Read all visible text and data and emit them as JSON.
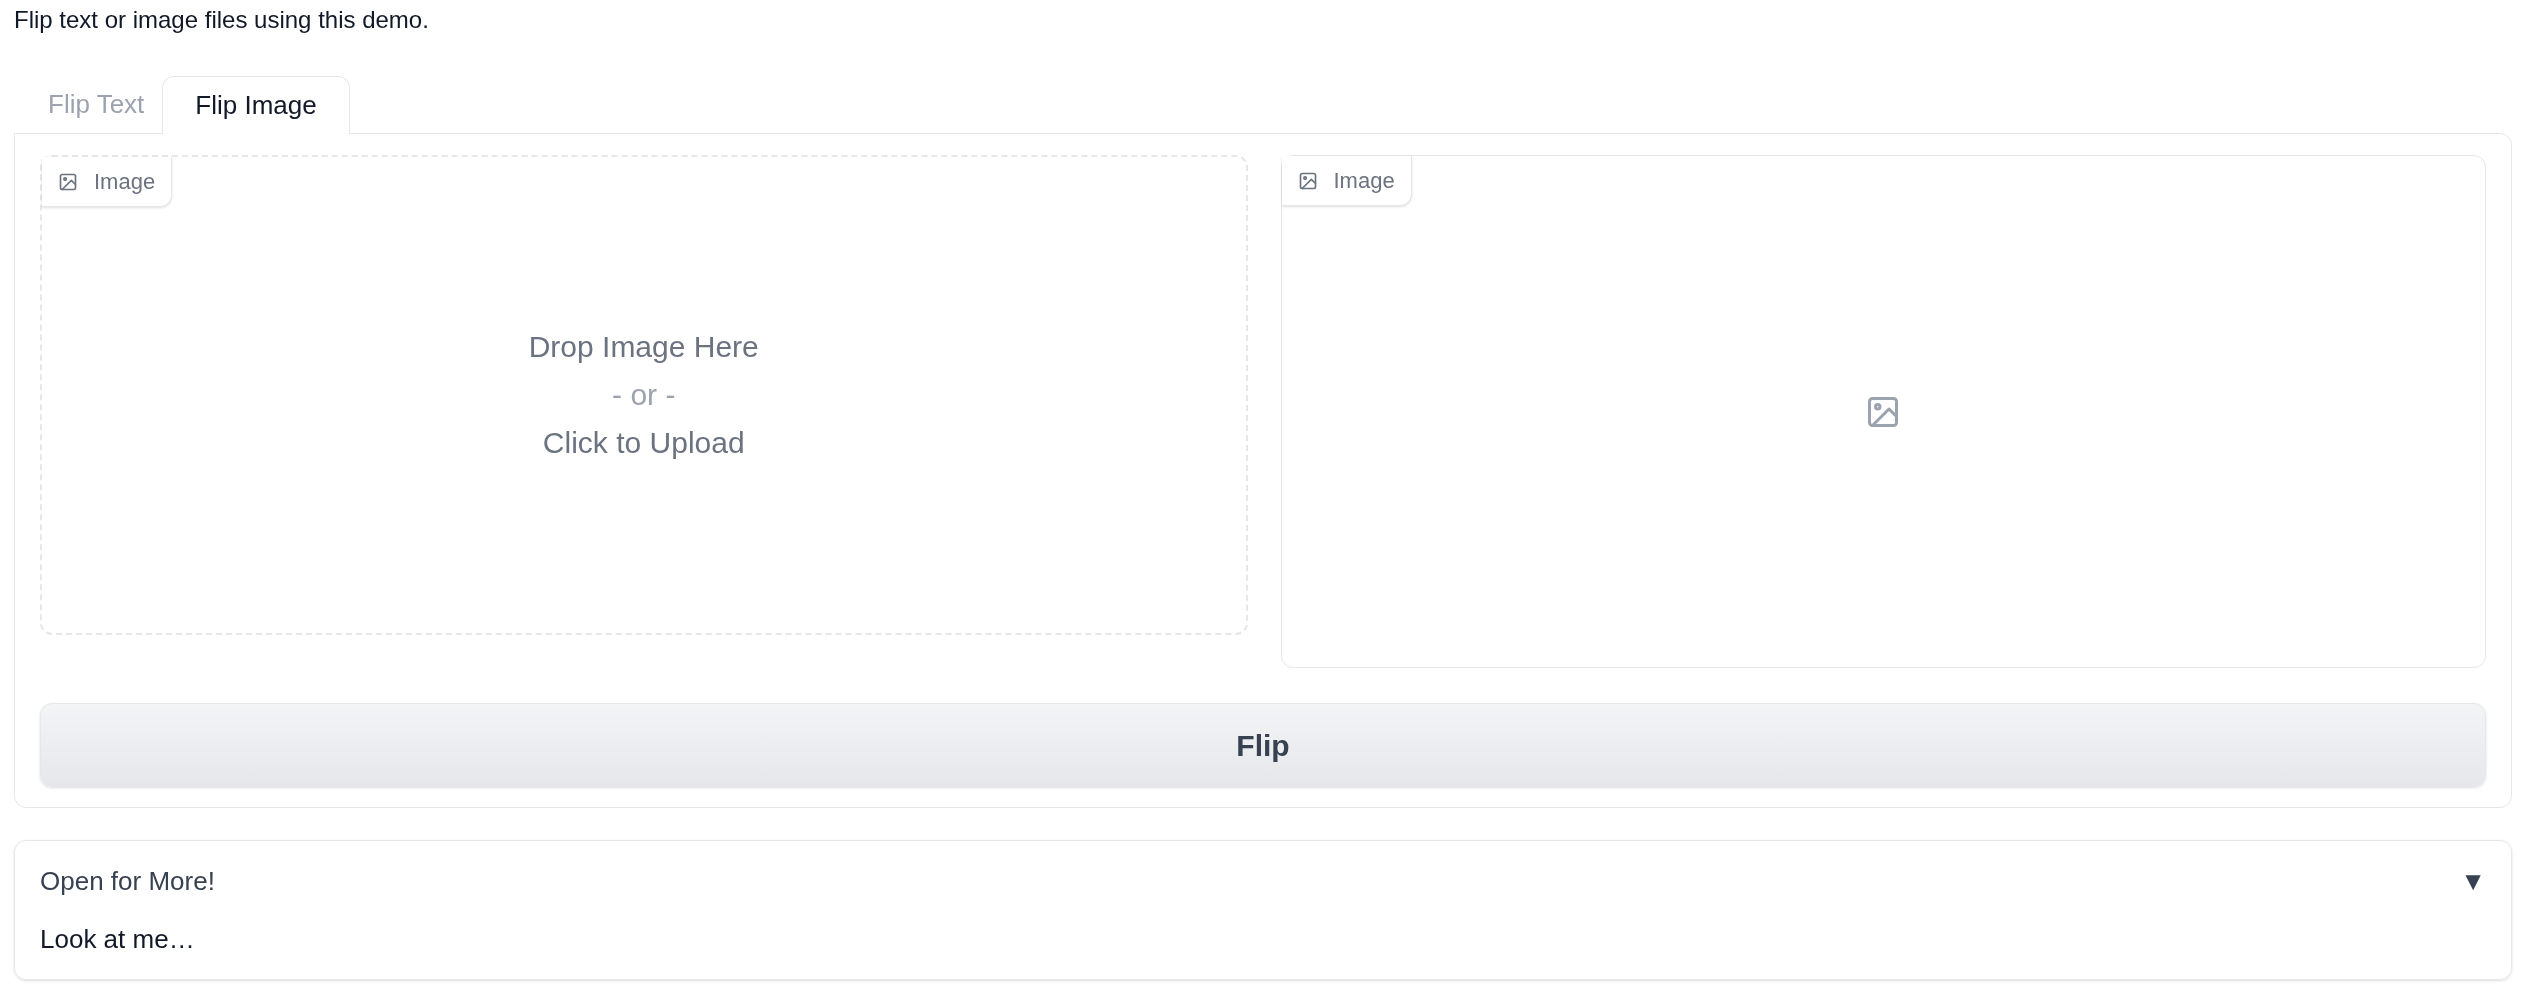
{
  "description": "Flip text or image files using this demo.",
  "tabs": [
    {
      "label": "Flip Text",
      "selected": false
    },
    {
      "label": "Flip Image",
      "selected": true
    }
  ],
  "input_image": {
    "label": "Image",
    "drop_text": "Drop Image Here",
    "or_text": "- or -",
    "upload_text": "Click to Upload"
  },
  "output_image": {
    "label": "Image"
  },
  "flip_button": "Flip",
  "accordion": {
    "title": "Open for More!",
    "arrow": "▼",
    "expanded": true,
    "content": "Look at me…"
  }
}
